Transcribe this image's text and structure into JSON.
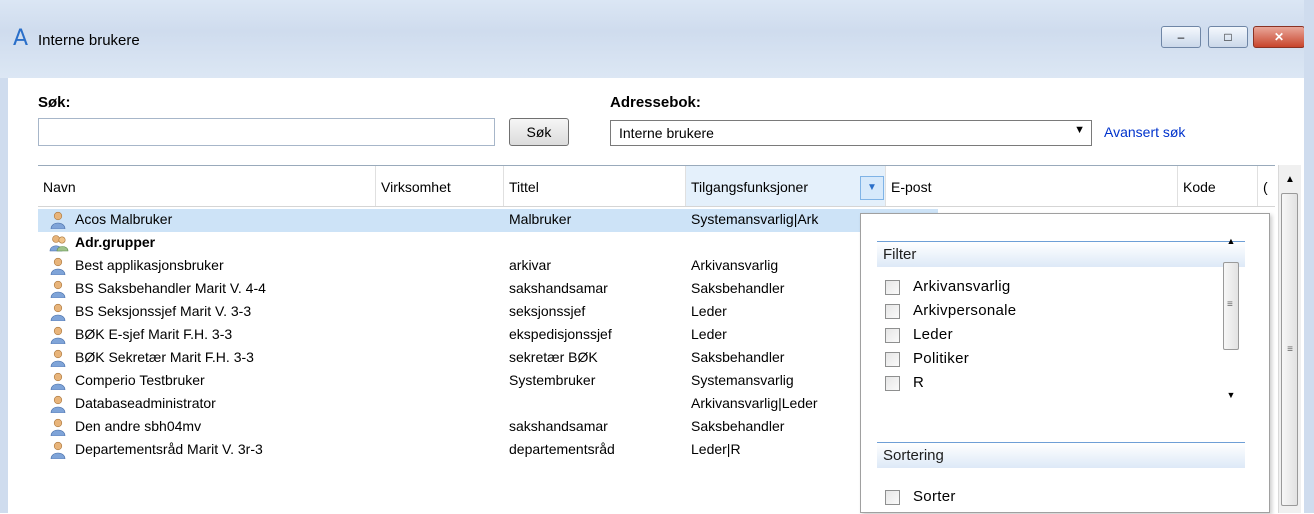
{
  "window": {
    "title": "Interne brukere",
    "app_icon": "A",
    "minimize": "–",
    "maximize": "□",
    "close": "✕"
  },
  "search": {
    "label": "Søk:",
    "value": "",
    "placeholder": "",
    "button": "Søk"
  },
  "addressbook": {
    "label": "Adressebok:",
    "selected": "Interne brukere",
    "advanced_link": "Avansert søk"
  },
  "table": {
    "columns": [
      "Navn",
      "Virksomhet",
      "Tittel",
      "Tilgangsfunksjoner",
      "E-post",
      "Kode",
      "("
    ],
    "rows": [
      {
        "name": "Acos Malbruker",
        "company": "",
        "title": "Malbruker",
        "access": "Systemansvarlig|Ark",
        "icon": "user-icon",
        "bold": false,
        "selected": true
      },
      {
        "name": "Adr.grupper",
        "company": "",
        "title": "",
        "access": "",
        "icon": "group-icon",
        "bold": true,
        "selected": false
      },
      {
        "name": "Best applikasjonsbruker",
        "company": "",
        "title": "arkivar",
        "access": "Arkivansvarlig",
        "icon": "user-icon",
        "bold": false,
        "selected": false
      },
      {
        "name": "BS Saksbehandler Marit V.  4-4",
        "company": "",
        "title": "sakshandsamar",
        "access": "Saksbehandler",
        "icon": "user-icon",
        "bold": false,
        "selected": false
      },
      {
        "name": "BS Seksjonssjef  Marit V.  3-3",
        "company": "",
        "title": "seksjonssjef",
        "access": "Leder",
        "icon": "user-icon",
        "bold": false,
        "selected": false
      },
      {
        "name": "BØK E-sjef Marit F.H. 3-3",
        "company": "",
        "title": "ekspedisjonssjef",
        "access": "Leder",
        "icon": "user-icon",
        "bold": false,
        "selected": false
      },
      {
        "name": "BØK Sekretær  Marit F.H. 3-3",
        "company": "",
        "title": "sekretær BØK",
        "access": "Saksbehandler",
        "icon": "user-icon",
        "bold": false,
        "selected": false
      },
      {
        "name": "Comperio Testbruker",
        "company": "",
        "title": "Systembruker",
        "access": "Systemansvarlig",
        "icon": "user-icon",
        "bold": false,
        "selected": false
      },
      {
        "name": "Databaseadministrator",
        "company": "",
        "title": "",
        "access": "Arkivansvarlig|Leder",
        "icon": "user-icon",
        "bold": false,
        "selected": false
      },
      {
        "name": "Den andre sbh04mv",
        "company": "",
        "title": "sakshandsamar",
        "access": "Saksbehandler",
        "icon": "user-icon",
        "bold": false,
        "selected": false
      },
      {
        "name": "Departementsråd Marit V. 3r-3",
        "company": "",
        "title": "departementsråd",
        "access": "Leder|R",
        "icon": "user-icon",
        "bold": false,
        "selected": false
      }
    ]
  },
  "filter_popup": {
    "filter_header": "Filter",
    "filter_options": [
      "Arkivansvarlig",
      "Arkivpersonale",
      "Leder",
      "Politiker",
      "R"
    ],
    "sort_header": "Sortering",
    "sort_options": [
      "Sorter"
    ]
  },
  "colors": {
    "accent": "#2a6fc9",
    "selection": "#cde3f7",
    "link": "#0033cc",
    "close_button": "#c8452c"
  }
}
